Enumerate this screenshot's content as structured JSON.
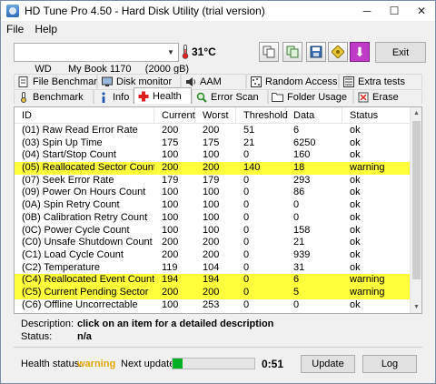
{
  "window": {
    "title": "HD Tune Pro 4.50 - Hard Disk Utility (trial version)",
    "minimize": "─",
    "maximize": "☐",
    "close": "✕"
  },
  "menu": {
    "file": "File",
    "help": "Help"
  },
  "toolbar": {
    "drive": "WD      My Book 1170     (2000 gB)",
    "temperature": "31°C",
    "exit": "Exit"
  },
  "tabs_row1": [
    {
      "label": "File Benchmark",
      "icon": "document-icon"
    },
    {
      "label": "Disk monitor",
      "icon": "monitor-icon"
    },
    {
      "label": "AAM",
      "icon": "speaker-icon"
    },
    {
      "label": "Random Access",
      "icon": "random-access-icon"
    },
    {
      "label": "Extra tests",
      "icon": "extra-tests-icon"
    }
  ],
  "tabs_row2": [
    {
      "label": "Benchmark",
      "icon": "benchmark-icon"
    },
    {
      "label": "Info",
      "icon": "info-icon"
    },
    {
      "label": "Health",
      "icon": "health-cross-icon",
      "active": true
    },
    {
      "label": "Error Scan",
      "icon": "magnifier-icon"
    },
    {
      "label": "Folder Usage",
      "icon": "folder-icon"
    },
    {
      "label": "Erase",
      "icon": "erase-icon"
    }
  ],
  "table": {
    "headers": [
      "ID",
      "Current",
      "Worst",
      "Threshold",
      "Data",
      "Status"
    ],
    "rows": [
      [
        "(01) Raw Read Error Rate",
        "200",
        "200",
        "51",
        "6",
        "ok"
      ],
      [
        "(03) Spin Up Time",
        "175",
        "175",
        "21",
        "6250",
        "ok"
      ],
      [
        "(04) Start/Stop Count",
        "100",
        "100",
        "0",
        "160",
        "ok"
      ],
      [
        "(05) Reallocated Sector Count",
        "200",
        "200",
        "140",
        "18",
        "warning"
      ],
      [
        "(07) Seek Error Rate",
        "179",
        "179",
        "0",
        "293",
        "ok"
      ],
      [
        "(09) Power On Hours Count",
        "100",
        "100",
        "0",
        "86",
        "ok"
      ],
      [
        "(0A) Spin Retry Count",
        "100",
        "100",
        "0",
        "0",
        "ok"
      ],
      [
        "(0B) Calibration Retry Count",
        "100",
        "100",
        "0",
        "0",
        "ok"
      ],
      [
        "(0C) Power Cycle Count",
        "100",
        "100",
        "0",
        "158",
        "ok"
      ],
      [
        "(C0) Unsafe Shutdown Count",
        "200",
        "200",
        "0",
        "21",
        "ok"
      ],
      [
        "(C1) Load Cycle Count",
        "200",
        "200",
        "0",
        "939",
        "ok"
      ],
      [
        "(C2) Temperature",
        "119",
        "104",
        "0",
        "31",
        "ok"
      ],
      [
        "(C4) Reallocated Event Count",
        "194",
        "194",
        "0",
        "6",
        "warning"
      ],
      [
        "(C5) Current Pending Sector",
        "200",
        "200",
        "0",
        "5",
        "warning"
      ],
      [
        "(C6) Offline Uncorrectable",
        "100",
        "253",
        "0",
        "0",
        "ok"
      ]
    ]
  },
  "description": {
    "label": "Description:",
    "value": "click on an item for a detailed description"
  },
  "status": {
    "label": "Status:",
    "value": "n/a"
  },
  "footer": {
    "health_label": "Health status:",
    "health_value": "warning",
    "next_label": "Next update:",
    "progress_fraction": 0.12,
    "countdown": "0:51",
    "update_button": "Update",
    "log_button": "Log"
  },
  "colors": {
    "warning_row": "#ffff3c",
    "health_warning": "#e0a800",
    "progress": "#06b025"
  }
}
